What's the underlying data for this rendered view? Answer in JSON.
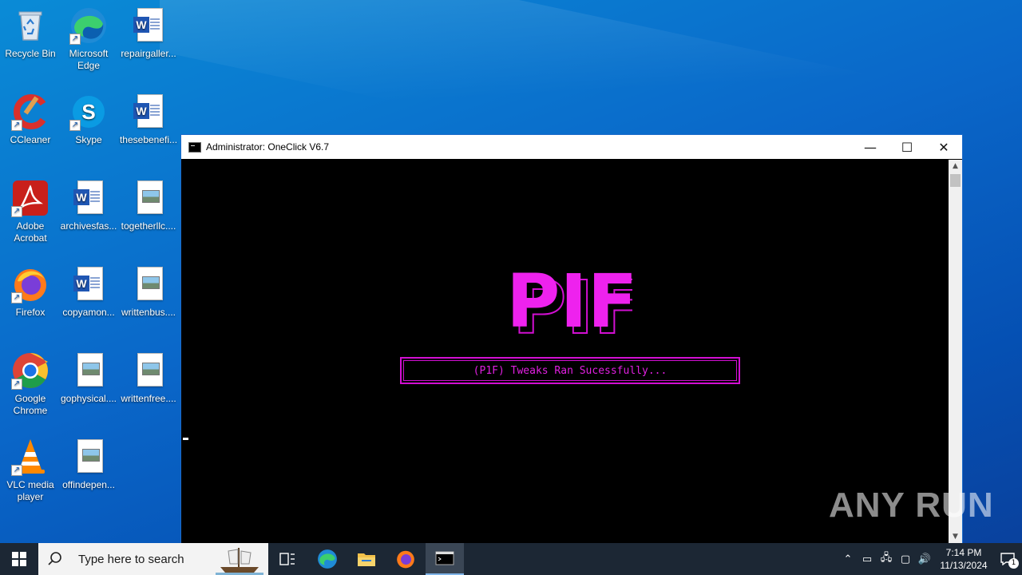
{
  "desktop": {
    "icons": [
      {
        "label": "Recycle Bin",
        "icon": "recycle-bin-icon"
      },
      {
        "label": "Microsoft Edge",
        "icon": "edge-icon"
      },
      {
        "label": "repairgaller...",
        "icon": "word-document-icon"
      },
      {
        "label": "CCleaner",
        "icon": "ccleaner-icon"
      },
      {
        "label": "Skype",
        "icon": "skype-icon"
      },
      {
        "label": "thesebenefi...",
        "icon": "word-document-icon"
      },
      {
        "label": "Adobe Acrobat",
        "icon": "acrobat-icon"
      },
      {
        "label": "archivesfas...",
        "icon": "word-document-icon"
      },
      {
        "label": "togetherllc....",
        "icon": "image-file-icon"
      },
      {
        "label": "Firefox",
        "icon": "firefox-icon"
      },
      {
        "label": "copyamon...",
        "icon": "word-document-icon"
      },
      {
        "label": "writtenbus....",
        "icon": "image-file-icon"
      },
      {
        "label": "Google Chrome",
        "icon": "chrome-icon"
      },
      {
        "label": "gophysical....",
        "icon": "image-file-icon"
      },
      {
        "label": "writtenfree....",
        "icon": "image-file-icon"
      },
      {
        "label": "VLC media player",
        "icon": "vlc-icon"
      },
      {
        "label": "offindepen...",
        "icon": "image-file-icon"
      }
    ]
  },
  "window": {
    "title": "Administrator:  OneClick V6.7",
    "minimize": "—",
    "maximize": "☐",
    "close": "✕"
  },
  "console": {
    "logo_text": "PIF",
    "message": "(P1F) Tweaks Ran Sucessfully...",
    "accent_color": "#e020e0"
  },
  "watermark": "ANY RUN",
  "taskbar": {
    "search_placeholder": "Type here to search",
    "time": "7:14 PM",
    "date": "11/13/2024",
    "notification_count": "1"
  }
}
